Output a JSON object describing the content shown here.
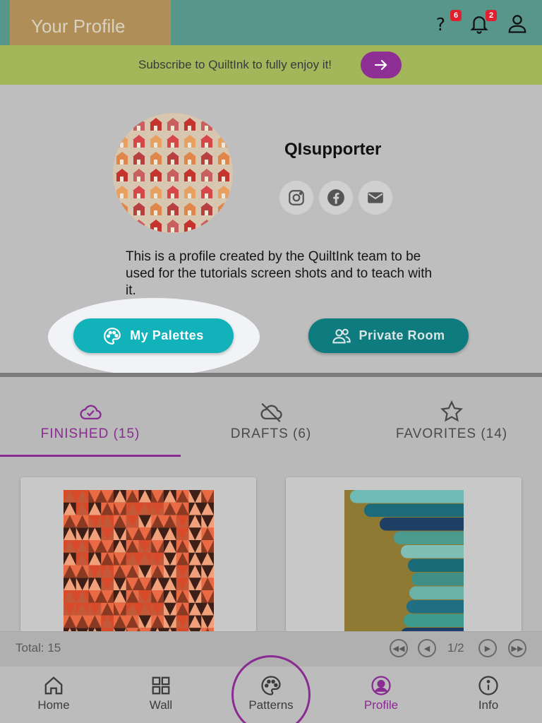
{
  "header": {
    "title": "Your Profile",
    "help_badge": "6",
    "notif_badge": "2",
    "help_icon": "question-icon",
    "notif_icon": "bell-icon",
    "account_icon": "user-icon"
  },
  "subscribe": {
    "text": "Subscribe to QuiltInk to fully enjoy it!",
    "button_icon": "arrow-right-icon"
  },
  "profile": {
    "username": "QIsupporter",
    "bio": "This is a profile created by the QuiltInk team to be used for the tutorials screen shots and to teach with it.",
    "social": [
      "instagram-icon",
      "facebook-icon",
      "mail-icon"
    ],
    "palettes_button": "My Palettes",
    "private_button": "Private Room"
  },
  "tabs": [
    {
      "label": "FINISHED (15)",
      "icon": "cloud-check-icon",
      "active": true
    },
    {
      "label": "DRAFTS (6)",
      "icon": "cloud-off-icon",
      "active": false
    },
    {
      "label": "FAVORITES (14)",
      "icon": "star-icon",
      "active": false
    }
  ],
  "pager": {
    "total": "Total: 15",
    "page": "1/2"
  },
  "nav": [
    {
      "label": "Home",
      "icon": "home-icon"
    },
    {
      "label": "Wall",
      "icon": "grid-icon"
    },
    {
      "label": "Patterns",
      "icon": "palette-icon"
    },
    {
      "label": "Profile",
      "icon": "profile-icon",
      "active": true
    },
    {
      "label": "Info",
      "icon": "info-icon"
    }
  ],
  "colors": {
    "accent": "#8a2a93",
    "teal": "#12b2bb",
    "header": "#58968b"
  }
}
